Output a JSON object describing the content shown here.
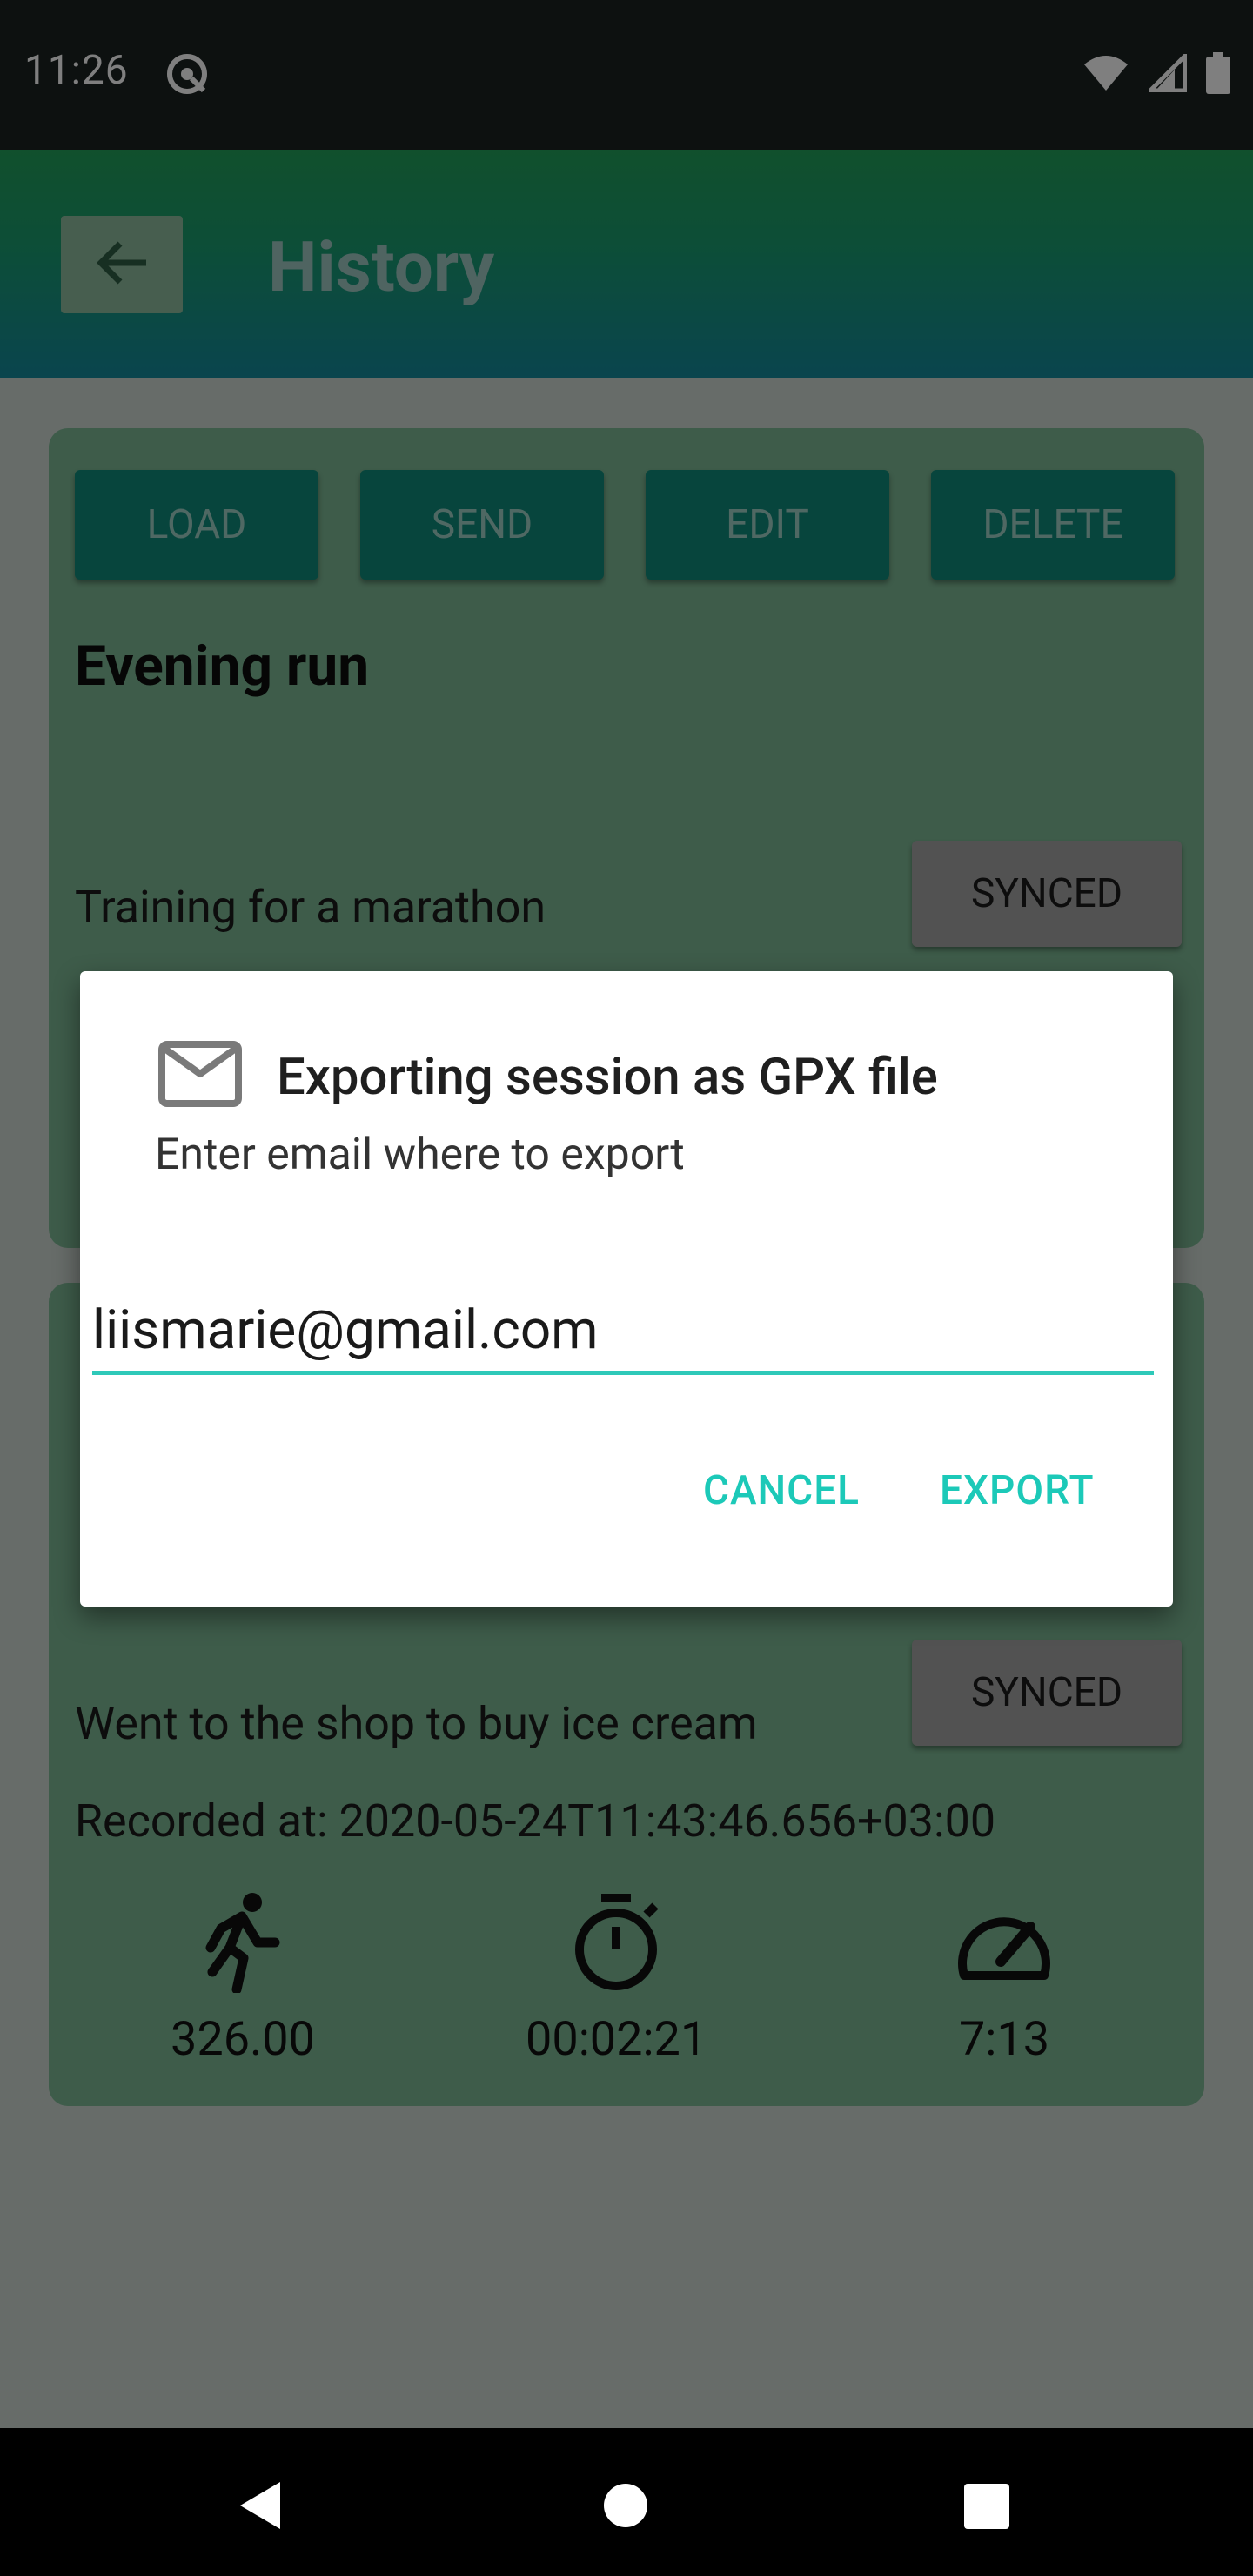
{
  "status_bar": {
    "time": "11:26",
    "notification_icon": "at-sign-icon",
    "icons": [
      "wifi-icon",
      "signal-icon",
      "battery-icon"
    ]
  },
  "app_bar": {
    "title": "History",
    "back_icon": "arrow-left-icon"
  },
  "sessions": [
    {
      "actions": [
        "LOAD",
        "SEND",
        "EDIT",
        "DELETE"
      ],
      "name": "Evening run",
      "description": "Training for a marathon",
      "sync_status": "SYNCED"
    },
    {
      "description": "Went to the shop to buy ice cream",
      "sync_status": "SYNCED",
      "recorded_label": "Recorded at:",
      "recorded_value": "2020-05-24T11:43:46.656+03:00",
      "stats": {
        "distance": "326.00",
        "duration": "00:02:21",
        "pace": "7:13"
      }
    }
  ],
  "dialog": {
    "icon": "mail-icon",
    "title": "Exporting session as GPX file",
    "message": "Enter email where to export",
    "email_value": "liismarie@gmail.com",
    "cancel_label": "CANCEL",
    "export_label": "EXPORT"
  },
  "colors": {
    "accent": "#1cc9b8",
    "card": "#7cb894",
    "button": "#0f8b7a"
  }
}
